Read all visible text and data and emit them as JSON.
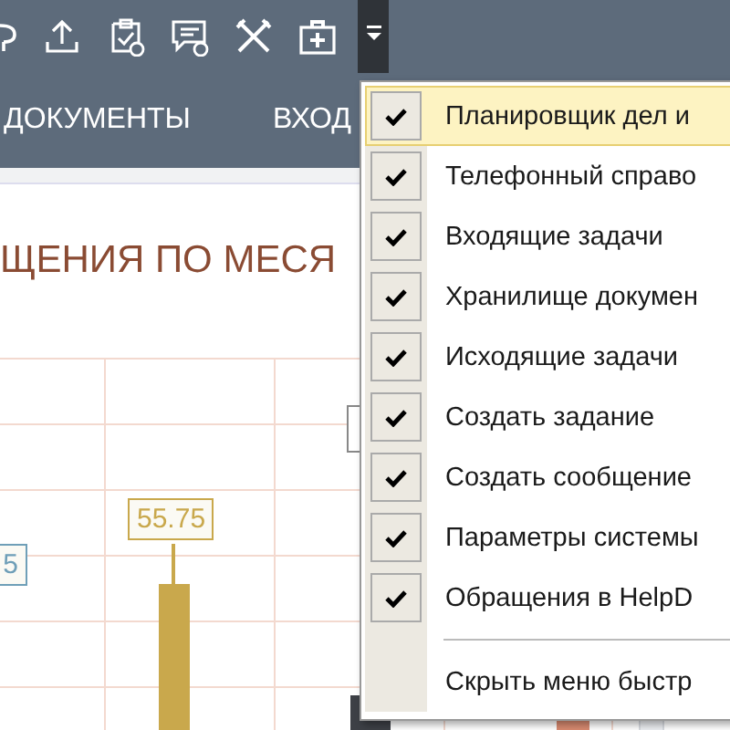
{
  "nav": {
    "tabs": [
      {
        "label": "ДОКУМЕНТЫ"
      },
      {
        "label": "ВХОД"
      }
    ]
  },
  "chart": {
    "title": "ЩЕНИЯ ПО МЕСЯ",
    "data_labels": [
      {
        "text": "5",
        "color": "#6f9fb8"
      },
      {
        "text": "55.75",
        "color": "#c9a84c"
      }
    ]
  },
  "quick_menu": {
    "items": [
      {
        "label": "Планировщик дел и",
        "checked": true,
        "selected": true
      },
      {
        "label": "Телефонный справо",
        "checked": true,
        "selected": false
      },
      {
        "label": "Входящие задачи",
        "checked": true,
        "selected": false
      },
      {
        "label": "Хранилище докумен",
        "checked": true,
        "selected": false
      },
      {
        "label": "Исходящие задачи",
        "checked": true,
        "selected": false
      },
      {
        "label": "Создать задание",
        "checked": true,
        "selected": false
      },
      {
        "label": "Создать сообщение",
        "checked": true,
        "selected": false
      },
      {
        "label": "Параметры системы",
        "checked": true,
        "selected": false
      },
      {
        "label": "Обращения в HelpD",
        "checked": true,
        "selected": false
      }
    ],
    "hide_label": "Скрыть меню быстр"
  }
}
